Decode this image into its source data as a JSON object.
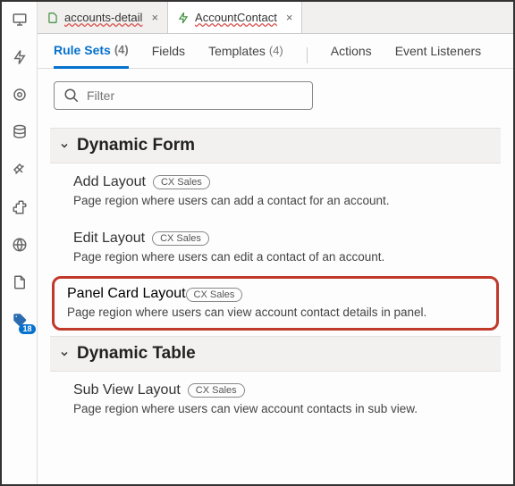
{
  "file_tabs": [
    {
      "label": "accounts-detail",
      "active": false
    },
    {
      "label": "AccountContact",
      "active": true
    }
  ],
  "subtabs": {
    "rule_sets": {
      "label": "Rule Sets",
      "count": "(4)"
    },
    "fields": {
      "label": "Fields"
    },
    "templates": {
      "label": "Templates",
      "count": "(4)"
    },
    "actions": {
      "label": "Actions"
    },
    "event_listeners": {
      "label": "Event Listeners"
    }
  },
  "filter": {
    "placeholder": "Filter"
  },
  "sections": {
    "dynamic_form": {
      "title": "Dynamic Form",
      "items": [
        {
          "title": "Add Layout",
          "pill": "CX Sales",
          "desc": "Page region where users can add a contact for an account."
        },
        {
          "title": "Edit Layout",
          "pill": "CX Sales",
          "desc": "Page region where users can edit a contact of an account."
        },
        {
          "title": "Panel Card Layout",
          "pill": "CX Sales",
          "desc": "Page region where users can view account contact details in panel."
        }
      ]
    },
    "dynamic_table": {
      "title": "Dynamic Table",
      "items": [
        {
          "title": "Sub View Layout",
          "pill": "CX Sales",
          "desc": "Page region where users can view account contacts in sub view."
        }
      ]
    }
  },
  "sidebar_badge": "18"
}
